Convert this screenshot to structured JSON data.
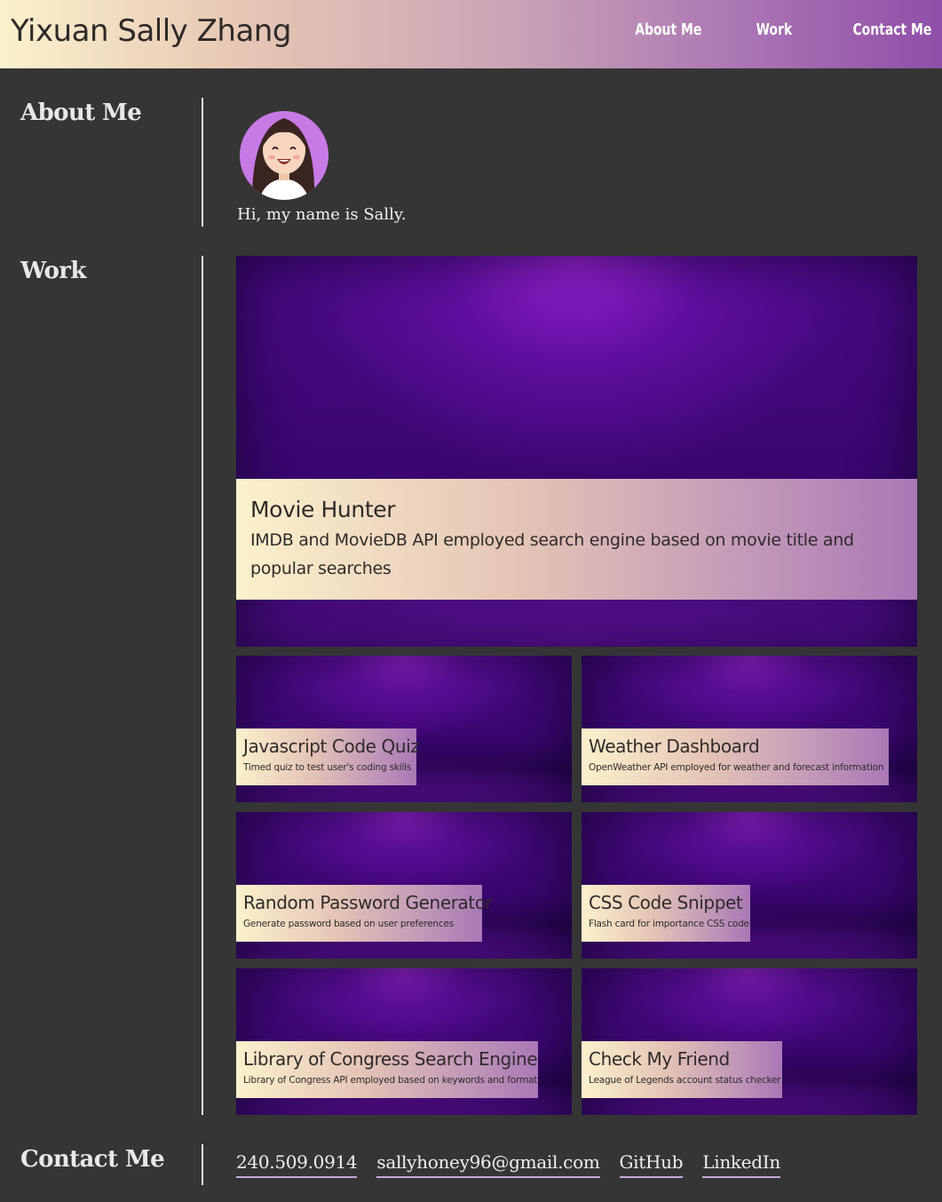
{
  "header": {
    "title": "Yixuan Sally Zhang",
    "nav": [
      "About Me",
      "Work",
      "Contact Me"
    ]
  },
  "about": {
    "heading": "About Me",
    "text": "Hi, my name is Sally."
  },
  "work": {
    "heading": "Work",
    "projects": [
      {
        "title": "Movie Hunter",
        "desc": "IMDB and MovieDB API employed search engine based on movie title and popular searches"
      },
      {
        "title": "Javascript Code Quiz",
        "desc": "Timed quiz to test user's coding skills"
      },
      {
        "title": "Weather Dashboard",
        "desc": "OpenWeather API employed for weather and forecast information"
      },
      {
        "title": "Random Password Generator",
        "desc": "Generate password based on user preferences"
      },
      {
        "title": "CSS Code Snippet",
        "desc": "Flash card for importance CSS code"
      },
      {
        "title": "Library of Congress Search Engine",
        "desc": "Library of Congress API employed based on keywords and format"
      },
      {
        "title": "Check My Friend",
        "desc": "League of Legends account status checker"
      }
    ]
  },
  "contact": {
    "heading": "Contact Me",
    "links": [
      "240.509.0914",
      "sallyhoney96@gmail.com",
      "GitHub",
      "LinkedIn"
    ]
  },
  "colors": {
    "background": "#353535",
    "header_gradient_start": "#fbf1cc",
    "header_gradient_end": "#8f4fa8",
    "card_purple": "#4a0a86",
    "link_underline": "#c9a7de"
  }
}
